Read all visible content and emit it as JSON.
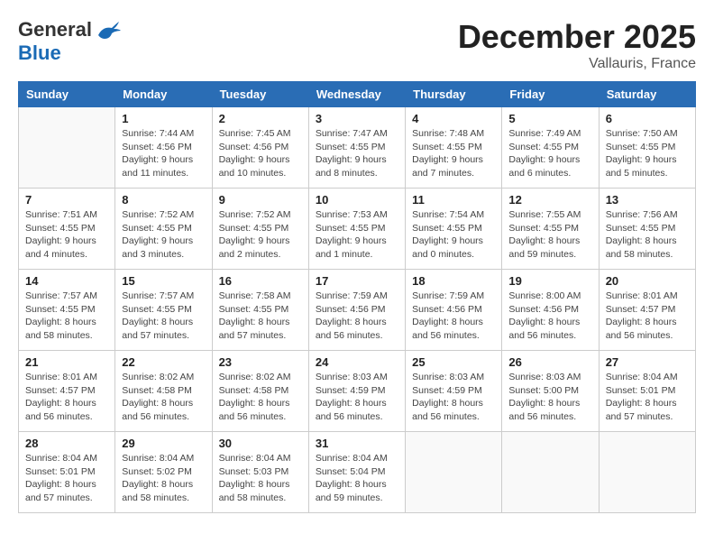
{
  "logo": {
    "general": "General",
    "blue": "Blue"
  },
  "title": "December 2025",
  "subtitle": "Vallauris, France",
  "weekdays": [
    "Sunday",
    "Monday",
    "Tuesday",
    "Wednesday",
    "Thursday",
    "Friday",
    "Saturday"
  ],
  "weeks": [
    [
      {
        "day": "",
        "sunrise": "",
        "sunset": "",
        "daylight": ""
      },
      {
        "day": "1",
        "sunrise": "Sunrise: 7:44 AM",
        "sunset": "Sunset: 4:56 PM",
        "daylight": "Daylight: 9 hours and 11 minutes."
      },
      {
        "day": "2",
        "sunrise": "Sunrise: 7:45 AM",
        "sunset": "Sunset: 4:56 PM",
        "daylight": "Daylight: 9 hours and 10 minutes."
      },
      {
        "day": "3",
        "sunrise": "Sunrise: 7:47 AM",
        "sunset": "Sunset: 4:55 PM",
        "daylight": "Daylight: 9 hours and 8 minutes."
      },
      {
        "day": "4",
        "sunrise": "Sunrise: 7:48 AM",
        "sunset": "Sunset: 4:55 PM",
        "daylight": "Daylight: 9 hours and 7 minutes."
      },
      {
        "day": "5",
        "sunrise": "Sunrise: 7:49 AM",
        "sunset": "Sunset: 4:55 PM",
        "daylight": "Daylight: 9 hours and 6 minutes."
      },
      {
        "day": "6",
        "sunrise": "Sunrise: 7:50 AM",
        "sunset": "Sunset: 4:55 PM",
        "daylight": "Daylight: 9 hours and 5 minutes."
      }
    ],
    [
      {
        "day": "7",
        "sunrise": "Sunrise: 7:51 AM",
        "sunset": "Sunset: 4:55 PM",
        "daylight": "Daylight: 9 hours and 4 minutes."
      },
      {
        "day": "8",
        "sunrise": "Sunrise: 7:52 AM",
        "sunset": "Sunset: 4:55 PM",
        "daylight": "Daylight: 9 hours and 3 minutes."
      },
      {
        "day": "9",
        "sunrise": "Sunrise: 7:52 AM",
        "sunset": "Sunset: 4:55 PM",
        "daylight": "Daylight: 9 hours and 2 minutes."
      },
      {
        "day": "10",
        "sunrise": "Sunrise: 7:53 AM",
        "sunset": "Sunset: 4:55 PM",
        "daylight": "Daylight: 9 hours and 1 minute."
      },
      {
        "day": "11",
        "sunrise": "Sunrise: 7:54 AM",
        "sunset": "Sunset: 4:55 PM",
        "daylight": "Daylight: 9 hours and 0 minutes."
      },
      {
        "day": "12",
        "sunrise": "Sunrise: 7:55 AM",
        "sunset": "Sunset: 4:55 PM",
        "daylight": "Daylight: 8 hours and 59 minutes."
      },
      {
        "day": "13",
        "sunrise": "Sunrise: 7:56 AM",
        "sunset": "Sunset: 4:55 PM",
        "daylight": "Daylight: 8 hours and 58 minutes."
      }
    ],
    [
      {
        "day": "14",
        "sunrise": "Sunrise: 7:57 AM",
        "sunset": "Sunset: 4:55 PM",
        "daylight": "Daylight: 8 hours and 58 minutes."
      },
      {
        "day": "15",
        "sunrise": "Sunrise: 7:57 AM",
        "sunset": "Sunset: 4:55 PM",
        "daylight": "Daylight: 8 hours and 57 minutes."
      },
      {
        "day": "16",
        "sunrise": "Sunrise: 7:58 AM",
        "sunset": "Sunset: 4:55 PM",
        "daylight": "Daylight: 8 hours and 57 minutes."
      },
      {
        "day": "17",
        "sunrise": "Sunrise: 7:59 AM",
        "sunset": "Sunset: 4:56 PM",
        "daylight": "Daylight: 8 hours and 56 minutes."
      },
      {
        "day": "18",
        "sunrise": "Sunrise: 7:59 AM",
        "sunset": "Sunset: 4:56 PM",
        "daylight": "Daylight: 8 hours and 56 minutes."
      },
      {
        "day": "19",
        "sunrise": "Sunrise: 8:00 AM",
        "sunset": "Sunset: 4:56 PM",
        "daylight": "Daylight: 8 hours and 56 minutes."
      },
      {
        "day": "20",
        "sunrise": "Sunrise: 8:01 AM",
        "sunset": "Sunset: 4:57 PM",
        "daylight": "Daylight: 8 hours and 56 minutes."
      }
    ],
    [
      {
        "day": "21",
        "sunrise": "Sunrise: 8:01 AM",
        "sunset": "Sunset: 4:57 PM",
        "daylight": "Daylight: 8 hours and 56 minutes."
      },
      {
        "day": "22",
        "sunrise": "Sunrise: 8:02 AM",
        "sunset": "Sunset: 4:58 PM",
        "daylight": "Daylight: 8 hours and 56 minutes."
      },
      {
        "day": "23",
        "sunrise": "Sunrise: 8:02 AM",
        "sunset": "Sunset: 4:58 PM",
        "daylight": "Daylight: 8 hours and 56 minutes."
      },
      {
        "day": "24",
        "sunrise": "Sunrise: 8:03 AM",
        "sunset": "Sunset: 4:59 PM",
        "daylight": "Daylight: 8 hours and 56 minutes."
      },
      {
        "day": "25",
        "sunrise": "Sunrise: 8:03 AM",
        "sunset": "Sunset: 4:59 PM",
        "daylight": "Daylight: 8 hours and 56 minutes."
      },
      {
        "day": "26",
        "sunrise": "Sunrise: 8:03 AM",
        "sunset": "Sunset: 5:00 PM",
        "daylight": "Daylight: 8 hours and 56 minutes."
      },
      {
        "day": "27",
        "sunrise": "Sunrise: 8:04 AM",
        "sunset": "Sunset: 5:01 PM",
        "daylight": "Daylight: 8 hours and 57 minutes."
      }
    ],
    [
      {
        "day": "28",
        "sunrise": "Sunrise: 8:04 AM",
        "sunset": "Sunset: 5:01 PM",
        "daylight": "Daylight: 8 hours and 57 minutes."
      },
      {
        "day": "29",
        "sunrise": "Sunrise: 8:04 AM",
        "sunset": "Sunset: 5:02 PM",
        "daylight": "Daylight: 8 hours and 58 minutes."
      },
      {
        "day": "30",
        "sunrise": "Sunrise: 8:04 AM",
        "sunset": "Sunset: 5:03 PM",
        "daylight": "Daylight: 8 hours and 58 minutes."
      },
      {
        "day": "31",
        "sunrise": "Sunrise: 8:04 AM",
        "sunset": "Sunset: 5:04 PM",
        "daylight": "Daylight: 8 hours and 59 minutes."
      },
      {
        "day": "",
        "sunrise": "",
        "sunset": "",
        "daylight": ""
      },
      {
        "day": "",
        "sunrise": "",
        "sunset": "",
        "daylight": ""
      },
      {
        "day": "",
        "sunrise": "",
        "sunset": "",
        "daylight": ""
      }
    ]
  ]
}
